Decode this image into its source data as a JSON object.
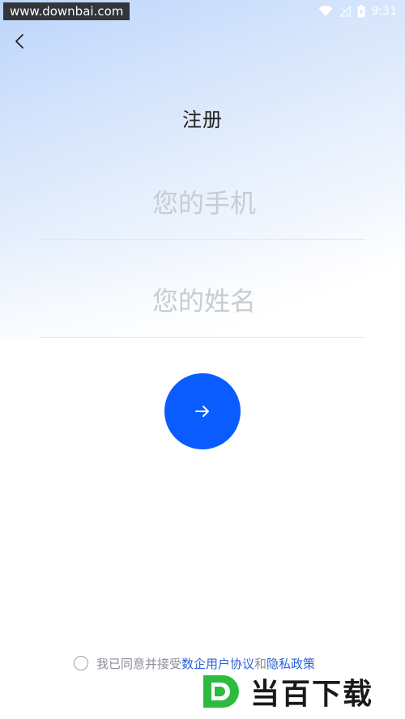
{
  "status_bar": {
    "watermark_url": "www.downbai.com",
    "time": "9:31"
  },
  "header": {
    "title": "注册"
  },
  "form": {
    "phone_placeholder": "您的手机",
    "name_placeholder": "您的姓名"
  },
  "agreement": {
    "prefix": "我已同意并接受",
    "terms_link": "数企用户协议",
    "connector": "和",
    "privacy_link": "隐私政策"
  },
  "watermark_logo": {
    "text": "当百下载"
  },
  "colors": {
    "primary": "#0a5cff",
    "link": "#2b5fd9",
    "placeholder": "#c8ccd3"
  }
}
